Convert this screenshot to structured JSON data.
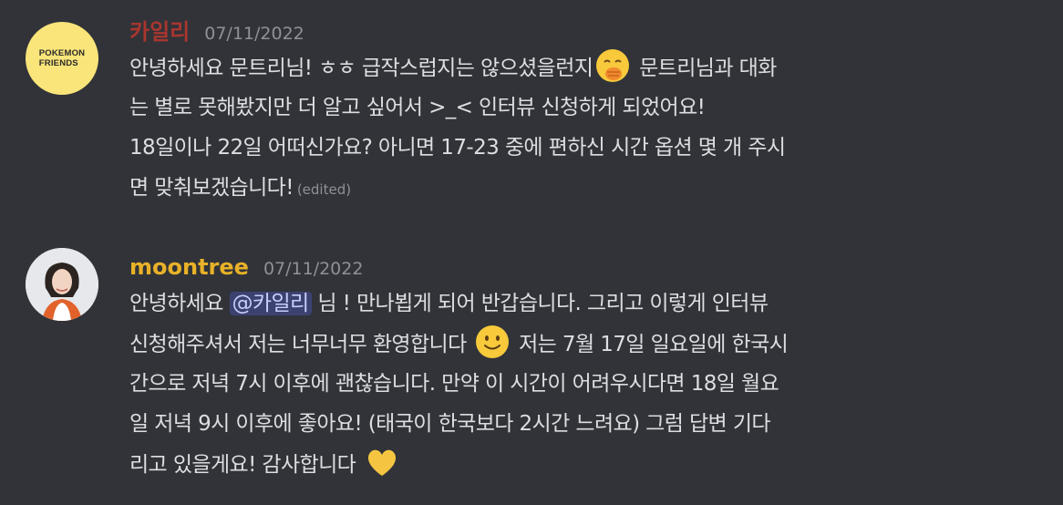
{
  "messages": [
    {
      "author": "카일리",
      "author_color": "#a8362f",
      "avatar_label": "POKEMON\nFRIENDS",
      "timestamp": "07/11/2022",
      "lines": [
        [
          "안녕하세요 문트리님! ㅎㅎ 급작스럽지는 않으셨을런지",
          "문트리님과 대화"
        ],
        [
          "는 별로 못해봤지만 더 알고 싶어서 >_< 인터뷰 신청하게 되었어요!"
        ],
        [
          "18일이나 22일 어떠신가요? 아니면 17-23 중에 편하신 시간 옵션 몇 개 주시"
        ],
        [
          "면 맞춰보겠습니다!"
        ]
      ],
      "edited_label": "(edited)"
    },
    {
      "author": "moontree",
      "author_color": "#e8b128",
      "timestamp": "07/11/2022",
      "mention": "@카일리",
      "lines": [
        [
          "안녕하세요",
          "님 ! 만나뵙게 되어 반갑습니다. 그리고 이렇게 인터뷰"
        ],
        [
          "신청해주셔서 저는 너무너무 환영합니다",
          "저는 7월 17일 일요일에 한국시"
        ],
        [
          "간으로 저녁 7시 이후에 괜찮습니다. 만약 이 시간이 어려우시다면 18일 월요"
        ],
        [
          "일 저녁 9시 이후에 좋아요! (태국이 한국보다 2시간 느려요) 그럼 답변 기다"
        ],
        [
          "리고 있을게요! 감사합니다"
        ]
      ]
    }
  ],
  "icons": {
    "emoji_1": "face-with-hand-over-mouth",
    "emoji_2": "slightly-smiling-face",
    "emoji_3": "yellow-heart"
  }
}
